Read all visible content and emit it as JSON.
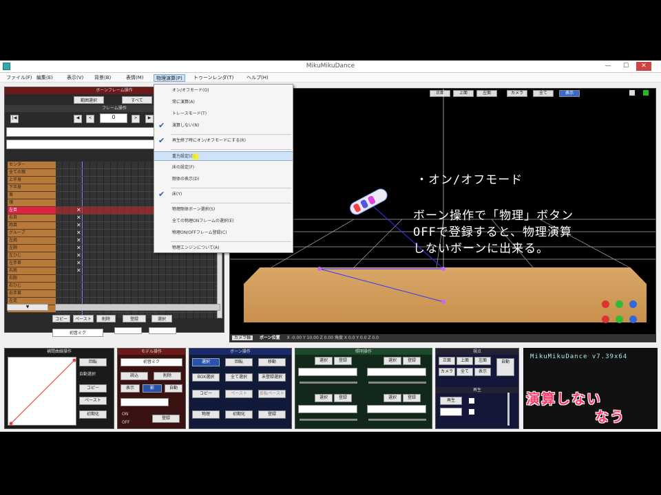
{
  "window": {
    "title": "MikuMikuDance",
    "min": "—",
    "max": "☐",
    "close": "✕"
  },
  "menubar": [
    {
      "label": "ファイル(F)"
    },
    {
      "label": "編集(E)"
    },
    {
      "label": "表示(V)"
    },
    {
      "label": "背景(B)"
    },
    {
      "label": "表情(M)"
    },
    {
      "label": "物理演算(P)"
    },
    {
      "label": "トゥーンレンダ(T)"
    },
    {
      "label": "ヘルプ(H)"
    }
  ],
  "timeline": {
    "header": "ボーンフレーム操作",
    "sub_header": "フレーム操作",
    "frame_value": "0",
    "btn_select_all": "範囲選択",
    "btn_other": "すべて",
    "bones": [
      "センター",
      "全ての親",
      "上半身",
      "下半身",
      "首",
      "頭",
      "左目",
      "右目",
      "両目",
      "グルーブ",
      "左肩",
      "左腕",
      "左ひじ",
      "左手首",
      "右肩",
      "右腕",
      "右ひじ",
      "右手首",
      "左足",
      "右足"
    ],
    "selected_index": 6,
    "key_rows": [
      6,
      7,
      8,
      9,
      10,
      11,
      12,
      13,
      14
    ],
    "key_glyph": "✕"
  },
  "dropdown": {
    "items": [
      {
        "label": "オン/オフモード(O)",
        "checked": false
      },
      {
        "label": "常に演算(A)",
        "checked": false
      },
      {
        "label": "トレースモード(T)",
        "checked": false
      },
      {
        "label": "演算しない(N)",
        "checked": true
      },
      {
        "label": "再生終了時にオン/オフモードにする(R)",
        "checked": true
      },
      {
        "label": "重力設定(G)",
        "checked": false,
        "hover": true
      },
      {
        "label": "床の設定(F)",
        "checked": false
      },
      {
        "label": "剛体の表示(D)",
        "checked": false
      },
      {
        "label": "床(Y)",
        "checked": true
      },
      {
        "label": "物理剛体ボーン選択(S)",
        "checked": false
      },
      {
        "label": "全ての物理ONフレームの選択(E)",
        "checked": false
      },
      {
        "label": "物理ON/OFFフレーム登録(C)",
        "checked": false
      },
      {
        "label": "物理エンジンについて(A)",
        "checked": false
      }
    ]
  },
  "viewport": {
    "top_buttons": [
      "正面",
      "上面",
      "左面",
      "カメラ",
      "全て",
      "表示"
    ],
    "annotation": {
      "line1": "・オン/オフモード",
      "line2": "ボーン操作で「物理」ボタン",
      "line3": "OFFで登録すると、物理演算",
      "line4": "しないボーンに出来る。"
    },
    "status_label": "カメラ軸",
    "status_pos_label": "ボーン位置",
    "status_values": "X  -0.00   Y  10.00   Z  0.00   角度  X  0.0   Y  0.0   Z  0.0"
  },
  "bottom": {
    "interp_header": "補間曲線操作",
    "model_header": "モデル操作",
    "bone_header": "ボーン操作",
    "light_header": "照明操作",
    "play_header": "再生",
    "view_header": "視点",
    "model_select": "初音ミク",
    "btn_load": "読込",
    "btn_delete": "削除",
    "btn_display": "表示",
    "btn_shadow": "影",
    "btn_register": "登録",
    "btn_select": "選択",
    "btn_rotate": "回転",
    "btn_move": "移動",
    "btn_box_select": "BOX選択",
    "btn_all_select": "全て選択",
    "btn_unregistered": "未登録選択",
    "btn_copy": "コピー",
    "btn_paste": "ペースト",
    "btn_reverse_paste": "反転ペースト",
    "btn_physics": "物理",
    "btn_init": "初期化",
    "btn_bone_register": "登録",
    "btn_play": "再生",
    "btn_auto": "自動",
    "check_auto_rotate": "自動選択",
    "radio_on": "ON",
    "radio_off": "OFF",
    "logo": "MikuMikuDance v7.39x64",
    "caption_line1": "演算しない",
    "caption_line2": "なう"
  }
}
